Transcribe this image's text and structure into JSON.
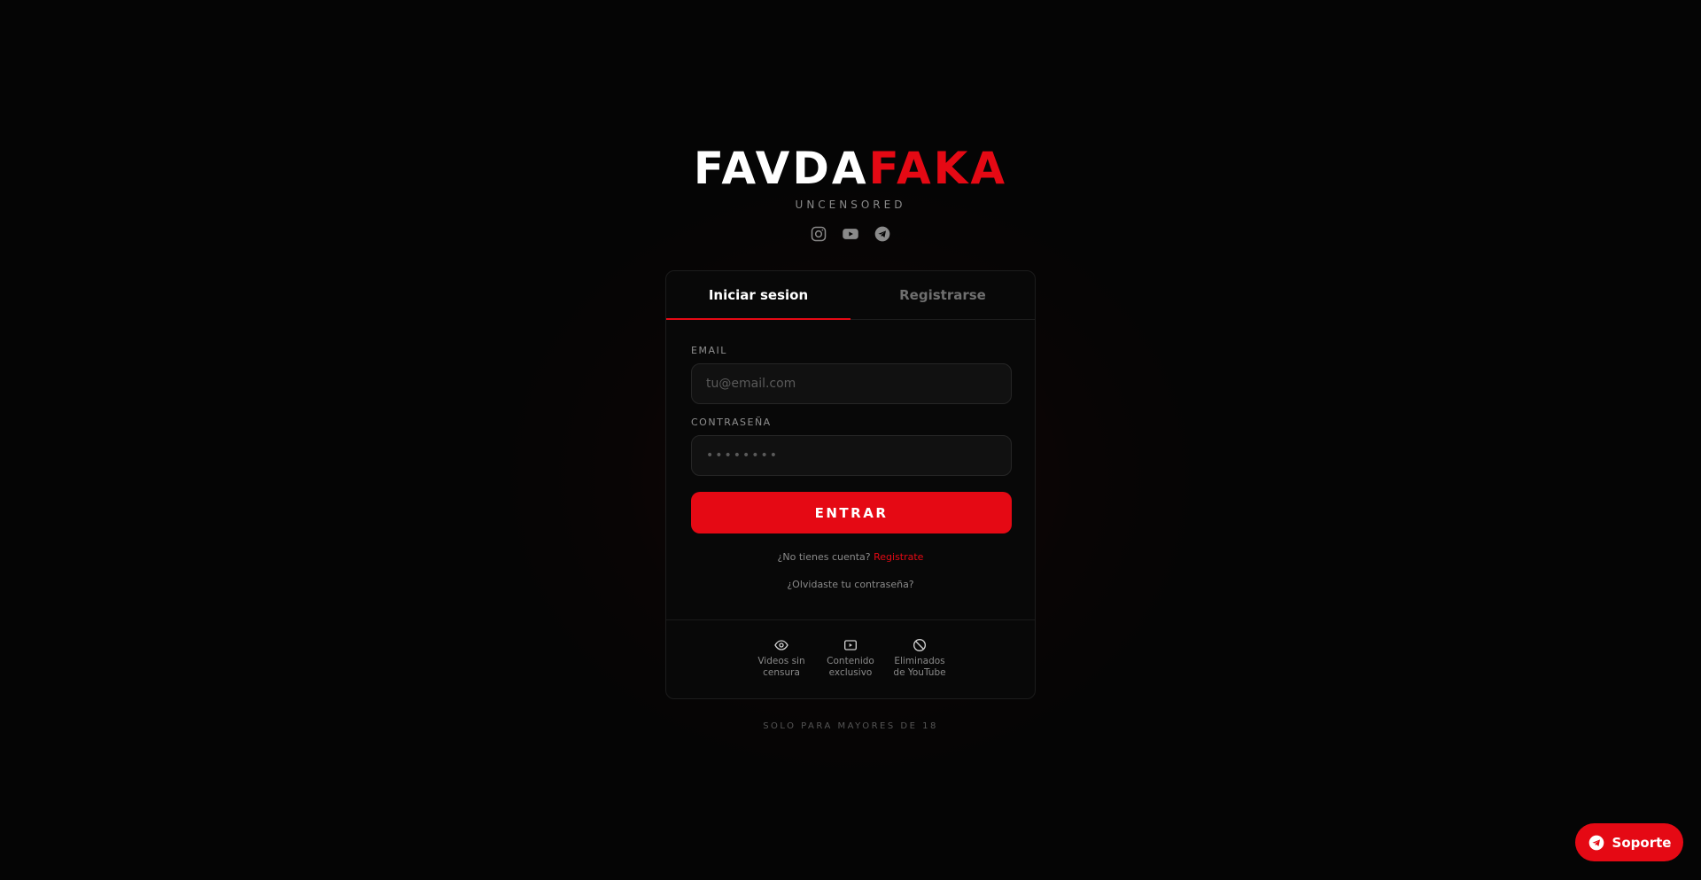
{
  "brand": {
    "logo_white": "FAVDA",
    "logo_red": "FAKA",
    "tagline": "UNCENSORED",
    "socials": [
      "instagram-icon",
      "youtube-icon",
      "telegram-icon"
    ]
  },
  "colors": {
    "accent": "#e50914",
    "background": "#050505",
    "card": "#080808"
  },
  "tabs": [
    {
      "label": "Iniciar sesion",
      "active": true
    },
    {
      "label": "Registrarse",
      "active": false
    }
  ],
  "form": {
    "email_label": "EMAIL",
    "email_placeholder": "tu@email.com",
    "email_value": "",
    "password_label": "CONTRASEÑA",
    "password_placeholder": "••••••••",
    "password_value": "",
    "submit_label": "ENTRAR",
    "no_account_text": "¿No tienes cuenta?",
    "register_link": "Registrate",
    "forgot_link": "¿Olvidaste tu contraseña?"
  },
  "features": [
    {
      "icon": "eye-icon",
      "line1": "Videos sin",
      "line2": "censura"
    },
    {
      "icon": "play-box-icon",
      "line1": "Contenido",
      "line2": "exclusivo"
    },
    {
      "icon": "ban-icon",
      "line1": "Eliminados",
      "line2": "de YouTube"
    }
  ],
  "age_notice": "SOLO PARA MAYORES DE 18",
  "support": {
    "label": "Soporte",
    "icon": "telegram-icon"
  }
}
